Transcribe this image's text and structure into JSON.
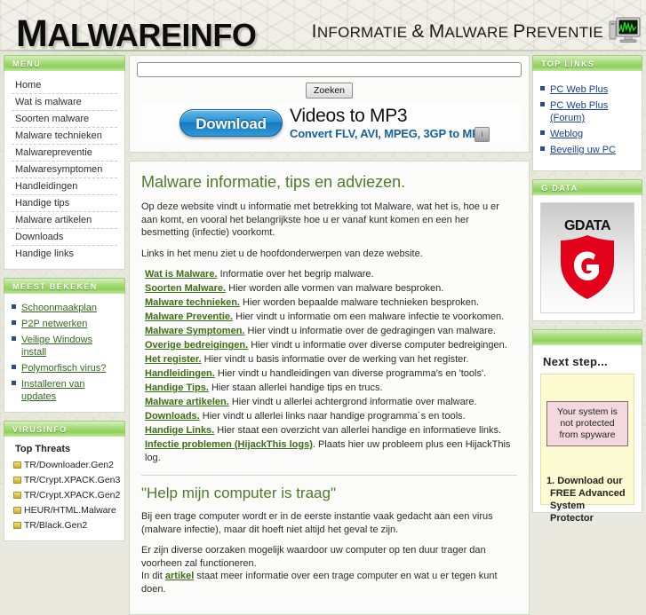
{
  "site": {
    "logo": "MALWAREINFO",
    "tagline": "INFORMATIE & MALWARE PREVENTIE",
    "monitor_icon": "monitor-icon"
  },
  "search": {
    "value": "",
    "placeholder": "",
    "button_label": "Zoeken"
  },
  "ad": {
    "button_label": "Download",
    "title": "Videos to MP3",
    "subtitle": "Convert FLV, AVI, MPEG, 3GP to MP3",
    "info_label": "i"
  },
  "sidebar_left": {
    "menu": {
      "title": "MENU",
      "items": [
        "Home",
        "Wat is malware",
        "Soorten malware",
        "Malware technieken",
        "Malwarepreventie",
        "Malwaresymptomen",
        "Handleidingen",
        "Handige tips",
        "Malware artikelen",
        "Downloads",
        "Handige links"
      ]
    },
    "most_viewed": {
      "title": "MEEST BEKEKEN",
      "items": [
        "Schoonmaakplan",
        "P2P netwerken",
        "Veilige Windows install",
        "Polymorfisch virus?",
        "Installeren van updates"
      ]
    },
    "virusinfo": {
      "title": "VIRUSINFO",
      "subtitle": "Top Threats",
      "items": [
        "TR/Downloader.Gen2",
        "TR/Crypt.XPACK.Gen3",
        "TR/Crypt.XPACK.Gen2",
        "HEUR/HTML.Malware",
        "TR/Black.Gen2"
      ]
    }
  },
  "sidebar_right": {
    "top_links": {
      "title": "TOP LINKS",
      "items": [
        "PC Web Plus",
        "PC Web Plus (Forum)",
        "Weblog",
        "Beveilig uw PC"
      ]
    },
    "gdata": {
      "title": "G DATA",
      "logo_text": "GDATA"
    },
    "next_step": {
      "title": "Next step...",
      "warning": "Your system is not protected from spyware",
      "step_one": "1. Download our FREE Advanced System Protector"
    }
  },
  "main": {
    "heading": "Malware informatie, tips en adviezen.",
    "intro1": "Op deze website vindt u informatie met betrekking tot Malware, wat het is, hoe u er aan komt, en vooral het belangrijkste hoe u er vanaf kunt komen en een her besmetting (infectie) voorkomt.",
    "intro2": "Links in het menu ziet u de hoofdonderwerpen van deze website.",
    "topics": [
      {
        "link": "Wat is Malware.",
        "text": " Informatie over het begrip malware."
      },
      {
        "link": "Soorten Malware.",
        "text": " Hier worden alle vormen van malware besproken."
      },
      {
        "link": "Malware technieken.",
        "text": " Hier worden bepaalde malware technieken besproken."
      },
      {
        "link": "Malware Preventie.",
        "text": " Hier vindt u informatie om een malware infectie te voorkomen."
      },
      {
        "link": "Malware Symptomen.",
        "text": " Hier vindt u informatie over de gedragingen van malware."
      },
      {
        "link": "Overige bedreigingen.",
        "text": " Hier vindt u informatie over diverse computer bedreigingen."
      },
      {
        "link": "Het register.",
        "text": " Hier vindt u basis informatie over de werking van het register."
      },
      {
        "link": "Handleidingen.",
        "text": " Hier vindt u handleidingen van diverse programma's en 'tools'."
      },
      {
        "link": "Handige Tips.",
        "text": " Hier staan allerlei handige tips en trucs."
      },
      {
        "link": "Malware artikelen.",
        "text": " Hier vindt u allerlei achtergrond informatie over malware."
      },
      {
        "link": "Downloads.",
        "text": " Hier vindt u allerlei links naar handige programma´s en tools."
      },
      {
        "link": "Handige Links.",
        "text": " Hier staat een overzicht van allerlei handige en informatieve links."
      },
      {
        "link": "Infectie problemen (HijackThis logs)",
        "text": ". Plaats hier uw probleem plus een HijackThis log."
      }
    ],
    "section2_heading": "\"Help mijn computer is traag\"",
    "section2_p1": "Bij een trage computer wordt er in de eerste instantie vaak gedacht aan een virus (malware infectie), maar dit hoeft niet altijd het geval te zijn.",
    "section2_p2a": "Er zijn diverse oorzaken mogelijk waardoor uw computer op ten duur trager dan voorheen zal functioneren.",
    "section2_p3a": "In dit ",
    "section2_p3link": "artikel",
    "section2_p3b": " staat meer informatie over een trage computer en wat u er tegen kunt doen."
  },
  "colors": {
    "accent_green": "#8ed058",
    "heading_green": "#4f7a2a",
    "link_green": "#3f6b18",
    "gdata_red": "#e2001a",
    "warn_bg": "#f3d9de"
  }
}
